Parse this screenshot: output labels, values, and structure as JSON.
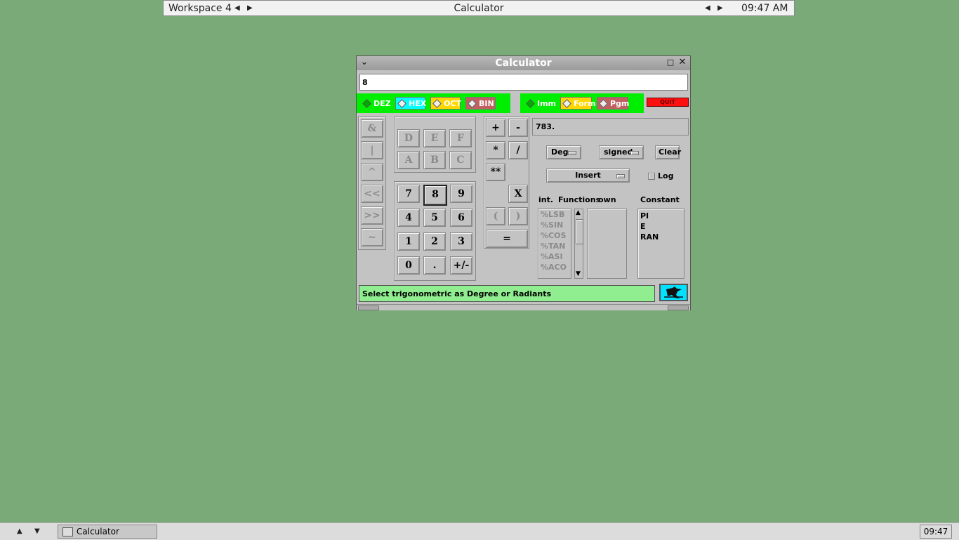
{
  "top_panel": {
    "workspace": "Workspace 4",
    "window_title": "Calculator",
    "time": "09:47 AM"
  },
  "window": {
    "title": "Calculator"
  },
  "entry": {
    "value": "8"
  },
  "bases": [
    "DEZ",
    "HEX",
    "OCT",
    "BIN"
  ],
  "modes": [
    "Imm",
    "Form",
    "Pgm"
  ],
  "quit": "QUIT",
  "bitops": [
    "&",
    "|",
    "^",
    "<<",
    ">>",
    "~"
  ],
  "hex_digits": [
    "D",
    "E",
    "F",
    "A",
    "B",
    "C"
  ],
  "digits": [
    "7",
    "8",
    "9",
    "4",
    "5",
    "6",
    "1",
    "2",
    "3",
    "0",
    ".",
    "+/-"
  ],
  "ops": {
    "plus": "+",
    "minus": "-",
    "mul": "*",
    "div": "/",
    "pow": "**",
    "x": "X",
    "lparen": "(",
    "rparen": ")",
    "eq": "="
  },
  "display": "783.",
  "options": {
    "angle": "Deg",
    "sign": "signed",
    "clear": "Clear",
    "insert": "Insert",
    "log": "Log"
  },
  "labels": {
    "int": "int.",
    "functions": "Functions",
    "own": "own",
    "constant": "Constant"
  },
  "functions": [
    "%LSB",
    "%SIN",
    "%COS",
    "%TAN",
    "%ASI",
    "%ACO"
  ],
  "constants": [
    "PI",
    "E",
    "RAN"
  ],
  "status": "Select trigonometric as Degree or Radiants",
  "taskbar": {
    "task": "Calculator",
    "clock": "09:47"
  }
}
